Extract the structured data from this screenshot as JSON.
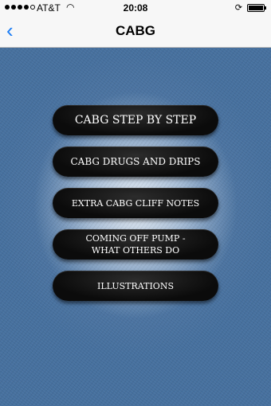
{
  "status_bar": {
    "carrier": "AT&T",
    "time": "20:08"
  },
  "nav": {
    "back_icon": "chevron-left-icon",
    "title": "CABG"
  },
  "menu": [
    {
      "label": "CABG STEP BY STEP"
    },
    {
      "label": "CABG DRUGS AND DRIPS"
    },
    {
      "label": "EXTRA CABG CLIFF NOTES"
    },
    {
      "label": "COMING OFF PUMP - WHAT OTHERS DO"
    },
    {
      "label": "ILLUSTRATIONS"
    }
  ],
  "colors": {
    "accent": "#1a7cf5",
    "background": "#46709e",
    "button": "#0b0b0b"
  }
}
